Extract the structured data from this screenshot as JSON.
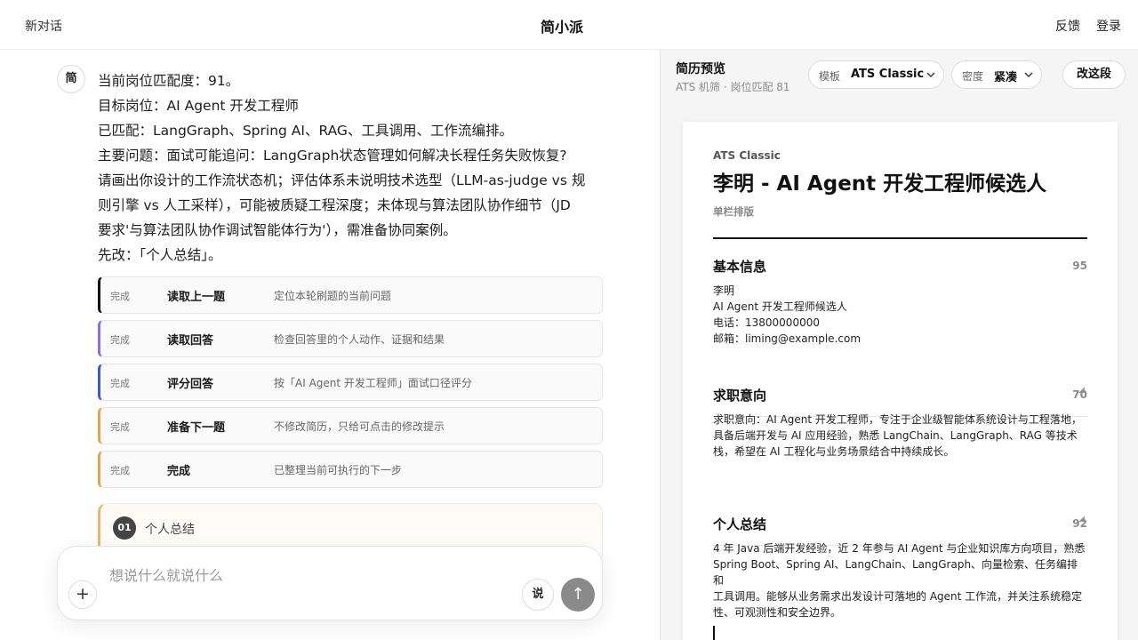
{
  "topbar": {
    "new_chat": "新对话",
    "app_title": "简小派",
    "feedback": "反馈",
    "login": "登录"
  },
  "chat": {
    "avatar": "简",
    "message_lines": [
      "当前岗位匹配度：91。",
      "目标岗位：AI Agent 开发工程师",
      "已匹配：LangGraph、Spring AI、RAG、工具调用、工作流编排。",
      "主要问题：面试可能追问：LangGraph状态管理如何解决长程任务失败恢复?",
      "请画出你设计的工作流状态机；评估体系未说明技术选型（LLM-as-judge vs 规",
      "则引擎 vs 人工采样），可能被质疑工程深度；未体现与算法团队协作细节（JD",
      "要求'与算法团队协作调试智能体行为'），需准备协同案例。",
      "先改：「个人总结」。"
    ],
    "steps": [
      {
        "status": "完成",
        "name": "读取上一题",
        "desc": "定位本轮刷题的当前问题",
        "color": "#111111"
      },
      {
        "status": "完成",
        "name": "读取回答",
        "desc": "检查回答里的个人动作、证据和结果",
        "color": "#8b6ee0"
      },
      {
        "status": "完成",
        "name": "评分回答",
        "desc": "按「AI Agent 开发工程师」面试口径评分",
        "color": "#3a5bd0"
      },
      {
        "status": "完成",
        "name": "准备下一题",
        "desc": "不修改简历，只给可点击的修改提示",
        "color": "#e0a64f"
      },
      {
        "status": "完成",
        "name": "完成",
        "desc": "已整理当前可执行的下一步",
        "color": "#e0a64f"
      }
    ],
    "section_card": {
      "number": "01",
      "title": "个人总结"
    },
    "composer": {
      "placeholder": "想说什么就说什么",
      "plus": "+",
      "voice": "说",
      "send": "↑"
    }
  },
  "preview": {
    "title": "简历预览",
    "subtitle": "ATS 机筛 · 岗位匹配 81",
    "template_label": "模板",
    "template_value": "ATS Classic",
    "density_label": "密度",
    "density_value": "紧凑",
    "edit_button": "改这段",
    "resume": {
      "template_name": "ATS Classic",
      "name": "李明 - AI Agent 开发工程师候选人",
      "layout": "单栏排版",
      "sections": [
        {
          "title": "基本信息",
          "score": "95",
          "lines": [
            "李明",
            "AI Agent 开发工程师候选人",
            "电话：13800000000",
            "邮箱：liming@example.com"
          ]
        },
        {
          "title": "求职意向",
          "score": "70",
          "lines": [
            "求职意向：AI Agent 开发工程师，专注于企业级智能体系统设计与工程落地，",
            "具备后端开发与 AI 应用经验，熟悉 LangChain、LangGraph、RAG 等技术",
            "栈，希望在 AI 工程化与业务场景结合中持续成长。"
          ]
        },
        {
          "title": "个人总结",
          "score": "92",
          "lines": [
            "4 年 Java 后端开发经验，近 2 年参与 AI Agent 与企业知识库方向项目，熟悉",
            "Spring Boot、Spring AI、LangChain、LangGraph、向量检索、任务编排和",
            "工具调用。能够从业务需求出发设计可落地的 Agent 工作流，并关注系统稳定",
            "性、可观测性和安全边界。"
          ]
        }
      ]
    }
  }
}
